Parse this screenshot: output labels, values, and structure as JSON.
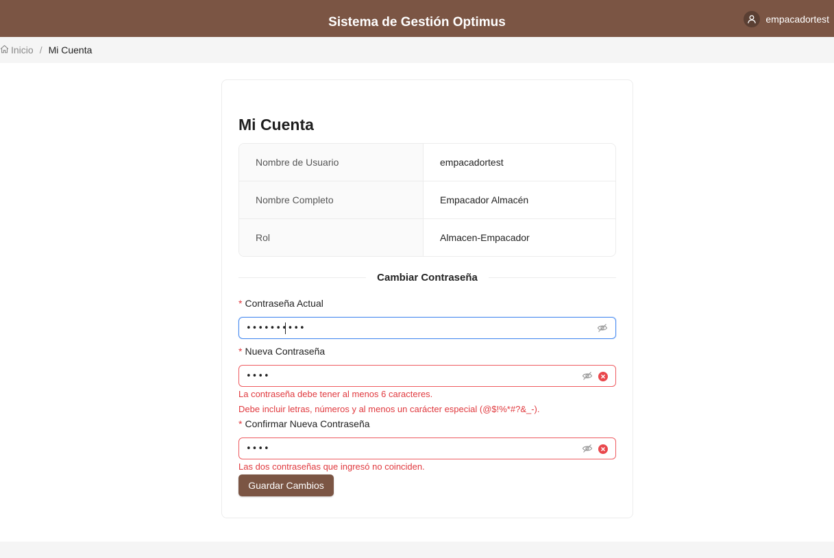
{
  "header": {
    "title": "Sistema de Gestión Optimus",
    "username": "empacadortest"
  },
  "breadcrumb": {
    "home": "Inicio",
    "separator": "/",
    "current": "Mi Cuenta"
  },
  "account": {
    "title": "Mi Cuenta",
    "rows": [
      {
        "label": "Nombre de Usuario",
        "value": "empacadortest"
      },
      {
        "label": "Nombre Completo",
        "value": "Empacador Almacén"
      },
      {
        "label": "Rol",
        "value": "Almacen-Empacador"
      }
    ]
  },
  "password": {
    "section_title": "Cambiar Contraseña",
    "required_mark": "*",
    "current": {
      "label": "Contraseña Actual",
      "value": "••••••••••"
    },
    "new": {
      "label": "Nueva Contraseña",
      "value": "••••",
      "errors": [
        "La contraseña debe tener al menos 6 caracteres.",
        "Debe incluir letras, números y al menos un carácter especial (@$!%*#?&_-)."
      ]
    },
    "confirm": {
      "label": "Confirmar Nueva Contraseña",
      "value": "••••",
      "errors": [
        "Las dos contraseñas que ingresó no coinciden."
      ]
    },
    "save_label": "Guardar Cambios"
  },
  "icons": {
    "user": "user-icon",
    "home": "home-icon",
    "eye_off": "eye-off-icon",
    "clear": "close-circle-icon"
  },
  "colors": {
    "brand": "#7b5544",
    "error": "#e0393e",
    "focus": "#4a8cf0"
  }
}
